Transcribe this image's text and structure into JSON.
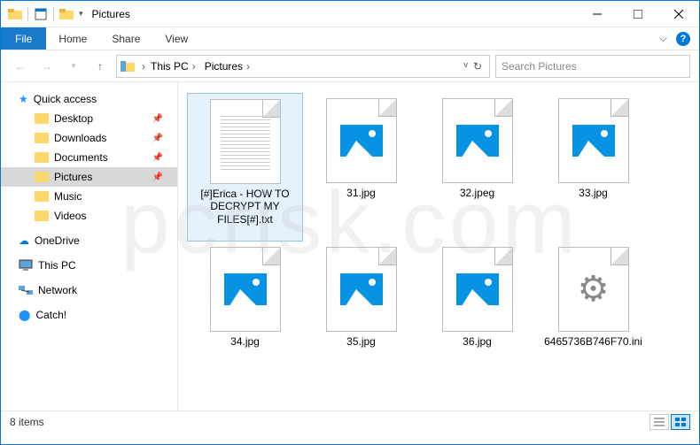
{
  "window": {
    "title": "Pictures"
  },
  "ribbon": {
    "file": "File",
    "tabs": [
      "Home",
      "Share",
      "View"
    ]
  },
  "breadcrumb": {
    "items": [
      "This PC",
      "Pictures"
    ]
  },
  "search": {
    "placeholder": "Search Pictures"
  },
  "sidebar": {
    "quick_access": "Quick access",
    "pinned": [
      {
        "label": "Desktop"
      },
      {
        "label": "Downloads"
      },
      {
        "label": "Documents"
      },
      {
        "label": "Pictures"
      },
      {
        "label": "Music"
      },
      {
        "label": "Videos"
      }
    ],
    "root": [
      {
        "label": "OneDrive"
      },
      {
        "label": "This PC"
      },
      {
        "label": "Network"
      },
      {
        "label": "Catch!"
      }
    ]
  },
  "files": [
    {
      "name": "[#]Erica - HOW TO DECRYPT MY FILES[#].txt",
      "type": "txt",
      "selected": true
    },
    {
      "name": "31.jpg",
      "type": "image"
    },
    {
      "name": "32.jpeg",
      "type": "image"
    },
    {
      "name": "33.jpg",
      "type": "image"
    },
    {
      "name": "34.jpg",
      "type": "image"
    },
    {
      "name": "35.jpg",
      "type": "image"
    },
    {
      "name": "36.jpg",
      "type": "image"
    },
    {
      "name": "6465736B746F70.ini",
      "type": "ini"
    }
  ],
  "status": {
    "text": "8 items"
  },
  "watermark": "pcrisk.com"
}
